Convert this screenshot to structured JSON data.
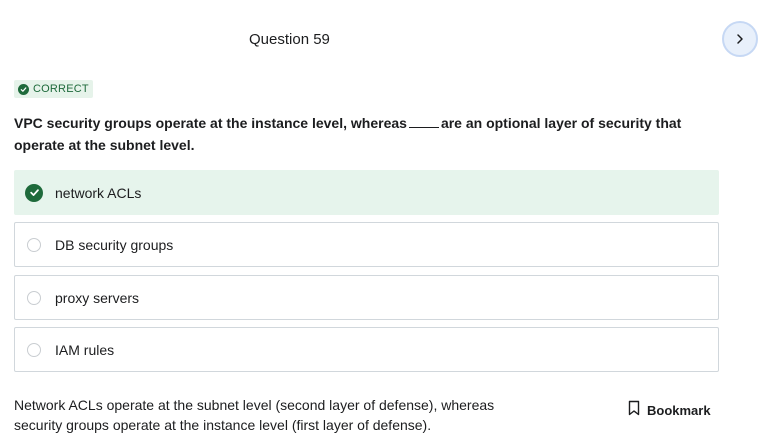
{
  "question": {
    "title": "Question 59",
    "status": "CORRECT",
    "text_part1": "VPC security groups operate at the instance level, whereas",
    "text_part2": "are an optional layer of security that operate at the subnet level."
  },
  "options": [
    {
      "label": "network ACLs",
      "selected": true
    },
    {
      "label": "DB security groups",
      "selected": false
    },
    {
      "label": "proxy servers",
      "selected": false
    },
    {
      "label": "IAM rules",
      "selected": false
    }
  ],
  "explanation": "Network ACLs operate at the subnet level (second layer of defense), whereas security groups operate at the instance level (first layer of defense).",
  "bookmark_label": "Bookmark",
  "icons": {
    "next": "chevron-right-icon",
    "correct": "check-circle-icon",
    "bookmark": "bookmark-icon"
  },
  "colors": {
    "correct_green": "#1e6a3b",
    "correct_bg": "#e6f4ec",
    "next_button_bg": "#e8f0fb"
  }
}
